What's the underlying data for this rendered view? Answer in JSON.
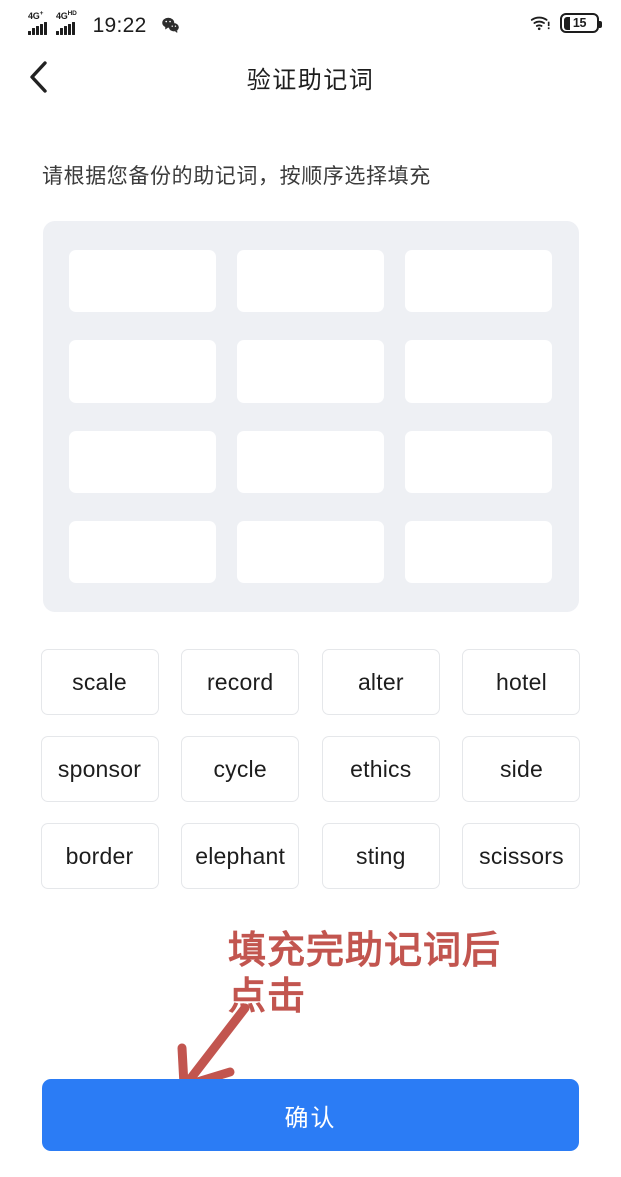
{
  "status_bar": {
    "signal_1_label": "4G",
    "signal_1_sup": "+",
    "signal_2_label": "4G",
    "signal_2_sup": "HD",
    "time": "19:22",
    "wechat_icon": "wechat-icon",
    "wifi_icon": "wifi-icon",
    "battery_level": "15"
  },
  "nav": {
    "back_icon": "chevron-left-icon",
    "title": "验证助记词"
  },
  "instruction": "请根据您备份的助记词，按顺序选择填充",
  "slots": {
    "count": 12,
    "values": [
      "",
      "",
      "",
      "",
      "",
      "",
      "",
      "",
      "",
      "",
      "",
      ""
    ]
  },
  "word_chips": [
    [
      "scale",
      "record",
      "alter",
      "hotel"
    ],
    [
      "sponsor",
      "cycle",
      "ethics",
      "side"
    ],
    [
      "border",
      "elephant",
      "sting",
      "scissors"
    ]
  ],
  "annotation": {
    "text": "填充完助记词后\n点击",
    "color": "#c2554f",
    "arrow_icon": "hand-drawn-arrow-icon"
  },
  "confirm_button": {
    "label": "确认",
    "color": "#2b7cf5"
  }
}
